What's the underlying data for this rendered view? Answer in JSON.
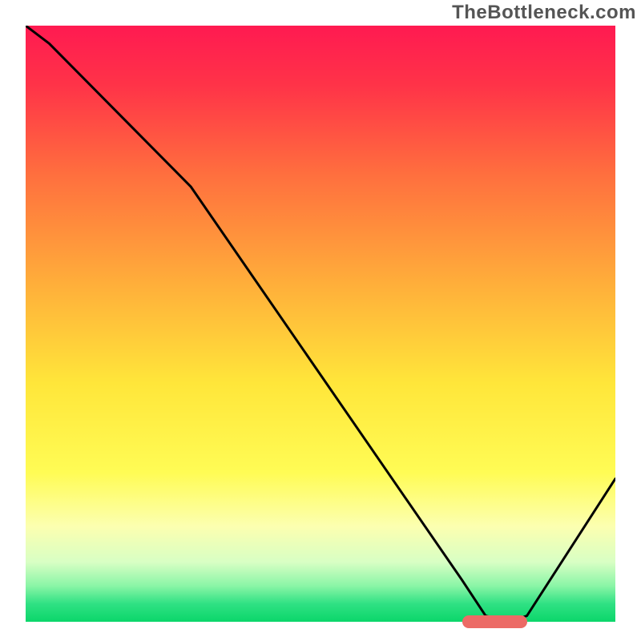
{
  "watermark": "TheBottleneck.com",
  "chart_data": {
    "type": "line",
    "title": "",
    "xlabel": "",
    "ylabel": "",
    "xlim": [
      0,
      100
    ],
    "ylim": [
      0,
      100
    ],
    "x": [
      0,
      4,
      25,
      28,
      74,
      78,
      82,
      85,
      100
    ],
    "values": [
      100,
      97,
      76,
      73,
      7,
      1,
      0,
      1,
      24
    ],
    "marker": {
      "x_start": 74,
      "x_end": 85,
      "y": 0
    },
    "gradient_stops": [
      {
        "pct": 0,
        "color": "#ff1a51"
      },
      {
        "pct": 10,
        "color": "#ff3348"
      },
      {
        "pct": 25,
        "color": "#ff6f3e"
      },
      {
        "pct": 45,
        "color": "#ffb43a"
      },
      {
        "pct": 60,
        "color": "#ffe63a"
      },
      {
        "pct": 75,
        "color": "#fffc55"
      },
      {
        "pct": 84,
        "color": "#fcffb0"
      },
      {
        "pct": 90,
        "color": "#d8ffc4"
      },
      {
        "pct": 94,
        "color": "#8af5a6"
      },
      {
        "pct": 97,
        "color": "#2fe183"
      },
      {
        "pct": 100,
        "color": "#0bd66a"
      }
    ]
  }
}
